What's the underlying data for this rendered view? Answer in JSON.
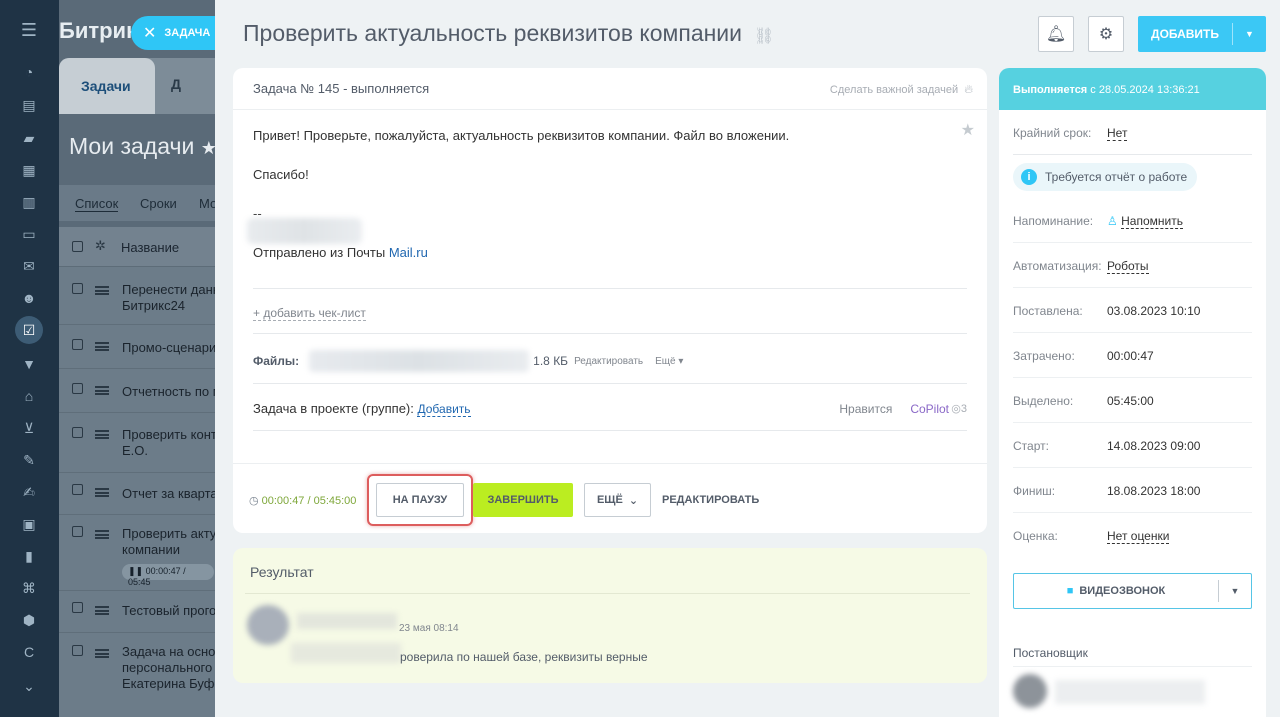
{
  "background_app": {
    "brand": "Битрик",
    "tab_active": "Задачи",
    "tab_second": "Д",
    "page_title": "Мои задачи",
    "views": [
      "Список",
      "Сроки",
      "Мо"
    ],
    "column_name": "Название",
    "rows": [
      {
        "text": "Перенести данн\nБитрикс24"
      },
      {
        "text": "Промо-сценари"
      },
      {
        "text": "Отчетность по м"
      },
      {
        "text": "Проверить конт\nЕ.О."
      },
      {
        "text": "Отчет за кварта"
      },
      {
        "text": "Проверить акту\nкомпании"
      },
      {
        "text": "Тестовый прого"
      },
      {
        "text": "Задача на основ\nперсонального\nЕкатерина Буфф"
      }
    ],
    "timer_chip": "00:00:47 / 05:45",
    "close_button": "ЗАДАЧА"
  },
  "task": {
    "title": "Проверить актуальность реквизитов компании",
    "number_status": "Задача № 145 - выполняется",
    "make_important": "Сделать важной задачей",
    "description": {
      "line1": "Привет! Проверьте, пожалуйста, актуальность реквизитов компании. Файл во вложении.",
      "line2": "Спасибо!",
      "line3": "--",
      "sent_from": "Отправлено из Почты ",
      "mail_link": "Mail.ru"
    },
    "add_checklist": "+ добавить чек-лист",
    "files_label": "Файлы:",
    "file_size": "1.8 КБ",
    "file_edit": "Редактировать",
    "file_more": "Ещё",
    "project_label": "Задача в проекте (группе): ",
    "project_add": "Добавить",
    "like": "Нравится",
    "copilot": "CoPilot",
    "views": "3",
    "timer": "00:00:47 / 05:45:00",
    "buttons": {
      "pause": "НА ПАУЗУ",
      "finish": "ЗАВЕРШИТЬ",
      "more": "ЕЩЁ",
      "edit": "РЕДАКТИРОВАТЬ"
    }
  },
  "header": {
    "add_button": "ДОБАВИТЬ"
  },
  "result": {
    "title": "Результат",
    "date": "23 мая 08:14",
    "text": "роверила по нашей базе, реквизиты верные"
  },
  "sidebar": {
    "status_prefix": "Выполняется",
    "status_suffix": " с 28.05.2024 13:36:21",
    "deadline_label": "Крайний срок:",
    "deadline_value": "Нет",
    "report_required": "Требуется отчёт о работе",
    "reminder_label": "Напоминание:",
    "reminder_value": "Напомнить",
    "automation_label": "Автоматизация:",
    "automation_value": "Роботы",
    "set_label": "Поставлена:",
    "set_value": "03.08.2023 10:10",
    "spent_label": "Затрачено:",
    "spent_value": "00:00:47",
    "allocated_label": "Выделено:",
    "allocated_value": "05:45:00",
    "start_label": "Старт:",
    "start_value": "14.08.2023 09:00",
    "finish_label": "Финиш:",
    "finish_value": "18.08.2023 18:00",
    "rating_label": "Оценка:",
    "rating_value": "Нет оценки",
    "video_call": "ВИДЕОЗВОНОК",
    "creator_label": "Постановщик"
  },
  "colors": {
    "accent": "#2fc6f6",
    "finish_button": "#bbed21",
    "status_header": "#56d1e0",
    "highlight": "#dd5d5d"
  }
}
